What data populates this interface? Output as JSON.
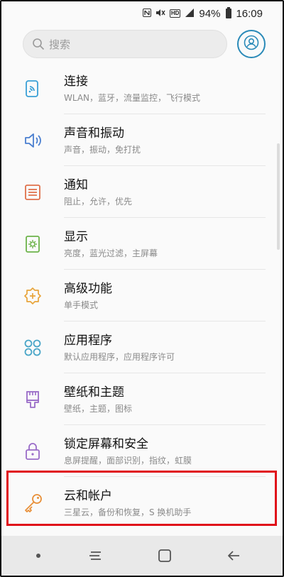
{
  "status_bar": {
    "battery": "94%",
    "time": "16:09",
    "hd_label": "HD"
  },
  "search": {
    "placeholder": "搜索"
  },
  "items": [
    {
      "title": "连接",
      "subtitle": "WLAN，蓝牙，流量监控，飞行模式",
      "icon": "connections-icon",
      "color": "#3aa0d6"
    },
    {
      "title": "声音和振动",
      "subtitle": "声音，振动，免打扰",
      "icon": "speaker-icon",
      "color": "#4a7fd0"
    },
    {
      "title": "通知",
      "subtitle": "阻止，允许，优先",
      "icon": "notification-icon",
      "color": "#e0704a"
    },
    {
      "title": "显示",
      "subtitle": "亮度，蓝光过滤，主屏幕",
      "icon": "display-icon",
      "color": "#6db34a"
    },
    {
      "title": "高级功能",
      "subtitle": "单手模式",
      "icon": "advanced-features-icon",
      "color": "#e8a43a"
    },
    {
      "title": "应用程序",
      "subtitle": "默认应用程序，应用程序许可",
      "icon": "apps-icon",
      "color": "#4aa6c8"
    },
    {
      "title": "壁纸和主题",
      "subtitle": "壁纸，主题，图标",
      "icon": "brush-icon",
      "color": "#9a6cc8"
    },
    {
      "title": "锁定屏幕和安全",
      "subtitle": "息屏提醒，面部识别，指纹，虹膜",
      "icon": "lock-icon",
      "color": "#9a6cc8"
    },
    {
      "title": "云和帐户",
      "subtitle": "三星云，备份和恢复，S 换机助手",
      "icon": "key-icon",
      "color": "#e8903a"
    }
  ],
  "colors": {
    "accent": "#2a8ab8",
    "highlight_border": "#e0101a"
  }
}
